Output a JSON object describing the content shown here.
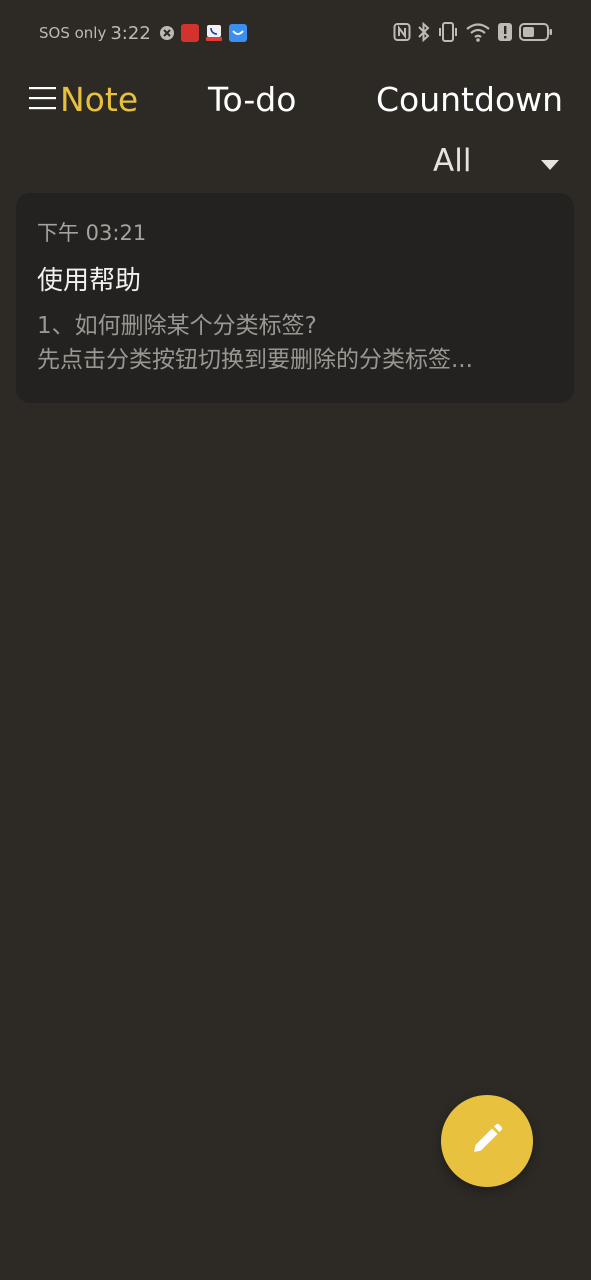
{
  "status_bar": {
    "carrier": "SOS only",
    "time": "3:22",
    "notification_icons": [
      "blocked-circle-icon",
      "app-badge-red-icon",
      "app-badge-phone-icon",
      "app-badge-blue-icon"
    ],
    "system_icons": [
      "nfc-icon",
      "bluetooth-icon",
      "vibrate-icon",
      "wifi-icon",
      "alert-icon",
      "battery-icon"
    ]
  },
  "tabs": [
    {
      "label": "Note",
      "active": true
    },
    {
      "label": "To-do",
      "active": false
    },
    {
      "label": "Countdown",
      "active": false
    }
  ],
  "filter": {
    "selected": "All"
  },
  "notes": [
    {
      "time": "下午 03:21",
      "title": "使用帮助",
      "preview_line1": "1、如何删除某个分类标签?",
      "preview_line2": "先点击分类按钮切换到要删除的分类标签..."
    }
  ],
  "colors": {
    "background": "#2d2a26",
    "card": "#242220",
    "accent": "#e7c03d"
  }
}
